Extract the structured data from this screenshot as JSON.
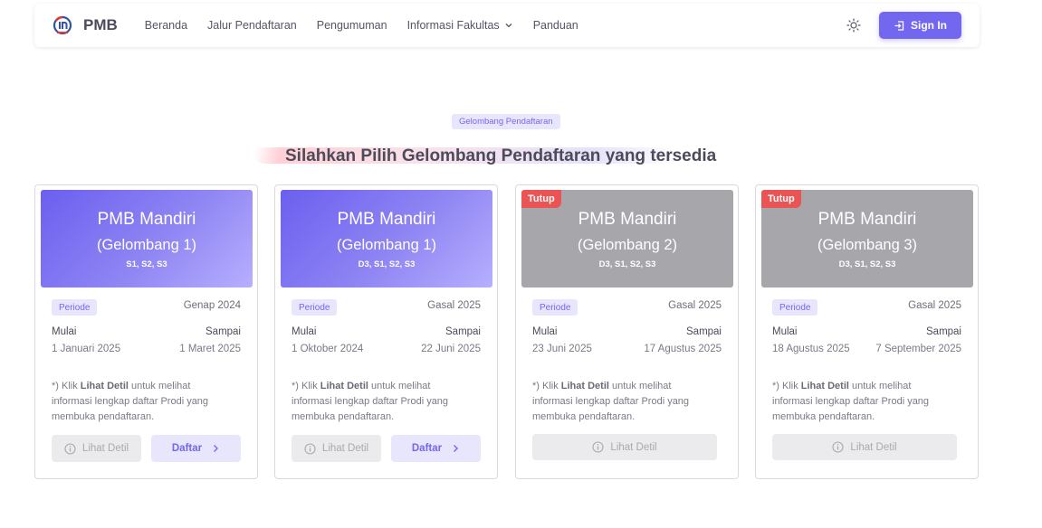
{
  "navbar": {
    "brand_name": "PMB",
    "links": [
      "Beranda",
      "Jalur Pendaftaran",
      "Pengumuman",
      "Informasi Fakultas",
      "Panduan"
    ],
    "sign_in_label": "Sign In"
  },
  "section": {
    "badge": "Gelombang Pendaftaran",
    "heading": "Silahkan Pilih Gelombang Pendaftaran yang tersedia"
  },
  "common": {
    "periode_label": "Periode",
    "start_label": "Mulai",
    "end_label": "Sampai",
    "note_prefix": "*) Klik ",
    "note_bold": "Lihat Detil",
    "note_suffix": " untuk melihat informasi lengkap daftar Prodi yang membuka pendaftaran.",
    "detail_label": "Lihat Detil",
    "register_label": "Daftar",
    "closed_label": "Tutup"
  },
  "cards": [
    {
      "title": "PMB Mandiri",
      "subtitle": "(Gelombang 1)",
      "levels": "S1, S2, S3",
      "semester": "Genap 2024",
      "start": "1 Januari 2025",
      "end": "1 Maret 2025",
      "status": "open"
    },
    {
      "title": "PMB Mandiri",
      "subtitle": "(Gelombang 1)",
      "levels": "D3, S1, S2, S3",
      "semester": "Gasal 2025",
      "start": "1 Oktober 2024",
      "end": "22 Juni 2025",
      "status": "open"
    },
    {
      "title": "PMB Mandiri",
      "subtitle": "(Gelombang 2)",
      "levels": "D3, S1, S2, S3",
      "semester": "Gasal 2025",
      "start": "23 Juni 2025",
      "end": "17 Agustus 2025",
      "status": "closed"
    },
    {
      "title": "PMB Mandiri",
      "subtitle": "(Gelombang 3)",
      "levels": "D3, S1, S2, S3",
      "semester": "Gasal 2025",
      "start": "18 Agustus 2025",
      "end": "7 September 2025",
      "status": "closed"
    }
  ],
  "colors": {
    "primary": "#7367f0",
    "danger": "#ea5455",
    "closed_banner": "#a7a7ab"
  }
}
